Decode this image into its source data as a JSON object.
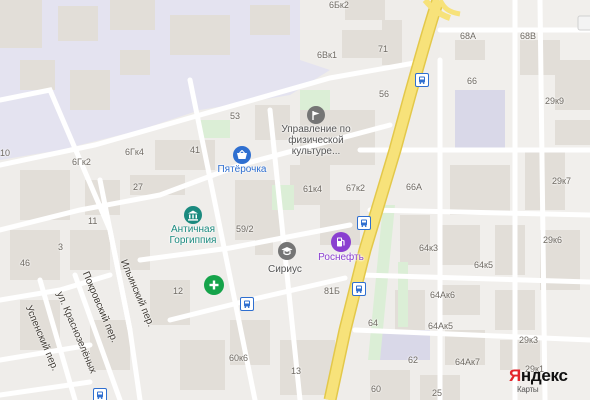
{
  "colors": {
    "background": "#efedea",
    "industrial": "#e4e3f0",
    "building": "#e2ded8",
    "green": "#dbeed6",
    "major_road": "#f7e27a",
    "road": "#ffffff",
    "poi_blue": "#2f6fd0",
    "poi_green": "#15a34a",
    "poi_teal": "#1b8a7f",
    "poi_purple": "#8a3fd0",
    "poi_gray": "#757575"
  },
  "house_numbers": [
    "6Бк2",
    "71",
    "6Вк1",
    "53",
    "56",
    "68А",
    "68В",
    "66",
    "29к9",
    "41",
    "6Гк4",
    "6Гк2",
    "10",
    "27",
    "61к4",
    "67к2",
    "66А",
    "29к7",
    "11",
    "59/2",
    "64к3",
    "29к6",
    "3",
    "46",
    "64к5",
    "12",
    "81Б",
    "64Ак6",
    "64Ак5",
    "64",
    "29к3",
    "62",
    "64Ак7",
    "29к1",
    "60к6",
    "13",
    "60",
    "25"
  ],
  "streets": [
    "Ильинский пер.",
    "Покровский пер.",
    "ул. Краснозелёных",
    "Успенский пер."
  ],
  "pois": {
    "uprav": "Управление по физической культуре...",
    "pyaterochka": "Пятёрочка",
    "antichnaya": "Античная Горгиппия",
    "sirius": "Сириус",
    "rosneft": "Роснефть"
  },
  "icons": {
    "uprav": "flag-icon",
    "pyaterochka": "shopping-basket-icon",
    "antichnaya": "museum-icon",
    "sirius": "education-icon",
    "rosneft": "fuel-pump-icon",
    "pharmacy": "medical-cross-icon",
    "bus_stop": "bus-stop-icon"
  },
  "logo": {
    "brand_first": "Я",
    "brand_rest": "ндекс",
    "sub": "Карты"
  }
}
